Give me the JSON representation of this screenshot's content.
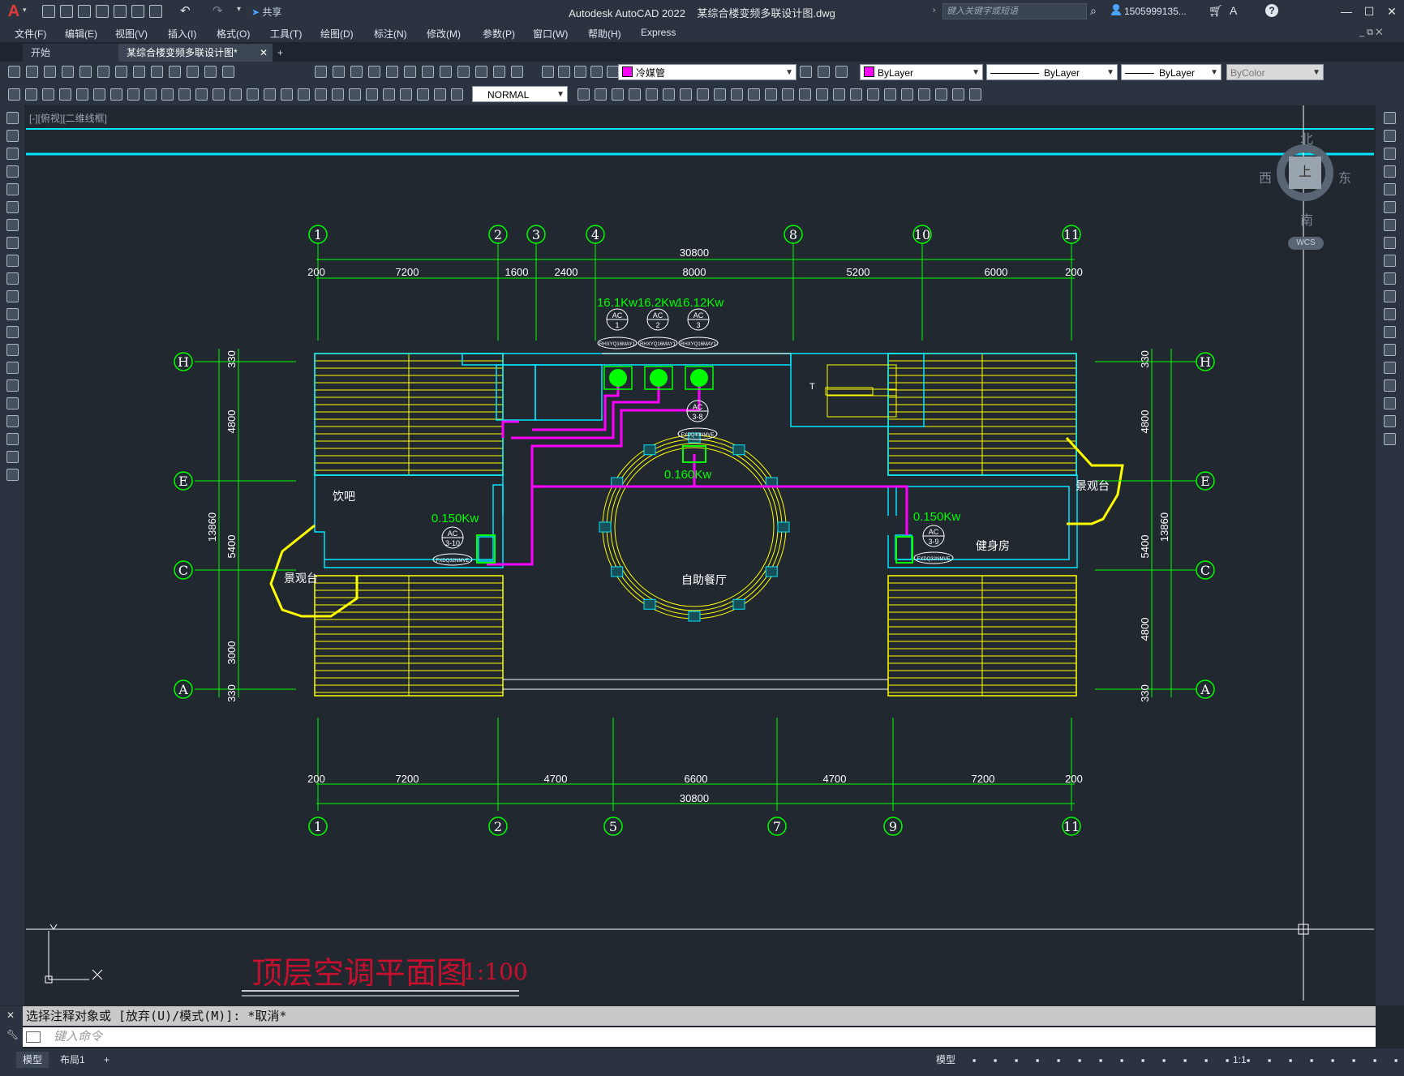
{
  "titlebar": {
    "app": "Autodesk AutoCAD 2022",
    "file": "某综合楼变频多联设计图.dwg",
    "share": "共享",
    "search_placeholder": "键入关键字或短语",
    "user": "1505999135...",
    "help_icon": "?"
  },
  "menu": [
    "文件(F)",
    "编辑(E)",
    "视图(V)",
    "插入(I)",
    "格式(O)",
    "工具(T)",
    "绘图(D)",
    "标注(N)",
    "修改(M)",
    "参数(P)",
    "窗口(W)",
    "帮助(H)",
    "Express"
  ],
  "tabs": {
    "start": "开始",
    "drawing": "某综合楼变频多联设计图*",
    "add": "+"
  },
  "toolbar": {
    "layer": "冷媒管",
    "color": "ByLayer",
    "linetype": "ByLayer",
    "lineweight": "ByLayer",
    "plotstyle": "ByColor",
    "dimstyle": "NORMAL"
  },
  "viewport": {
    "label": "[-][俯视][二维线框]"
  },
  "viewcube": {
    "north": "北",
    "south": "南",
    "east": "东",
    "west": "西",
    "top": "上",
    "wcs": "WCS"
  },
  "plan": {
    "title": "顶层空调平面图",
    "scale": "1:100",
    "top_axes": [
      "1",
      "2",
      "3",
      "4",
      "8",
      "10",
      "11"
    ],
    "bottom_axes": [
      "1",
      "2",
      "5",
      "7",
      "9",
      "11"
    ],
    "side_axes": [
      "H",
      "E",
      "C",
      "A"
    ],
    "top_dims": [
      "200",
      "7200",
      "1600",
      "2400",
      "8000",
      "5200",
      "6000",
      "200"
    ],
    "top_total": "30800",
    "bottom_dims": [
      "200",
      "7200",
      "4700",
      "6600",
      "4700",
      "7200",
      "200"
    ],
    "bottom_total": "30800",
    "side_dims": [
      "330",
      "4800",
      "5400",
      "3000",
      "330"
    ],
    "side_dims_right": [
      "330",
      "4800",
      "5400",
      "4800",
      "330"
    ],
    "side_total": "13860",
    "units": [
      {
        "power": "16.1Kw",
        "tag": "AC",
        "no": "1",
        "model": "RHXYQ16MAY1"
      },
      {
        "power": "16.2Kw",
        "tag": "AC",
        "no": "2",
        "model": "RHXYQ16MAY1"
      },
      {
        "power": "16.12Kw",
        "tag": "AC",
        "no": "3",
        "model": "RHXYQ16MAY1"
      }
    ],
    "indoor": [
      {
        "power": "0.160Kw",
        "tag": "AC",
        "no": "3-8",
        "model": "FXDQ40NMVE"
      },
      {
        "power": "0.150Kw",
        "tag": "AC",
        "no": "3-10",
        "model": "FXDQ32NMVE"
      },
      {
        "power": "0.150Kw",
        "tag": "AC",
        "no": "3-9",
        "model": "FXDQ32NMVE"
      }
    ],
    "rooms": {
      "bar": "饮吧",
      "view_l": "景观台",
      "view_r": "景观台",
      "gym": "健身房",
      "dining": "自助餐厅",
      "stair": "T"
    }
  },
  "command": {
    "history": "选择注释对象或 [放弃(U)/模式(M)]: *取消*",
    "placeholder": "键入命令"
  },
  "status": {
    "model_tab": "模型",
    "layout_tab": "布局1",
    "model_btn": "模型",
    "scale": "1:1"
  },
  "colors": {
    "green": "#00ff00",
    "yellow": "#ffff00",
    "cyan": "#00ffff",
    "magenta": "#ff00ff",
    "title_red": "#c8102e"
  }
}
